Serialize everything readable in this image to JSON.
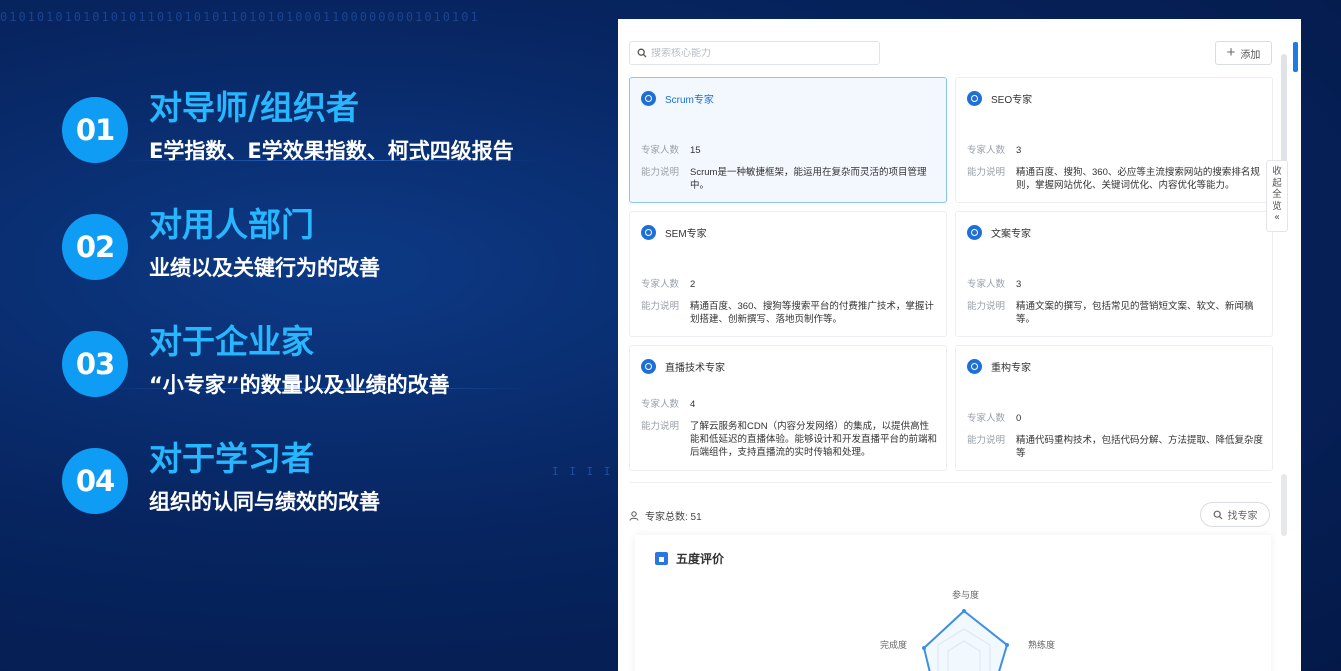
{
  "background_binary": "0101010101010101101010101101010100011000000001010101",
  "points": [
    {
      "num": "01",
      "title": "对导师/组织者",
      "desc": "E学指数、E学效果指数、柯式四级报告"
    },
    {
      "num": "02",
      "title": "对用人部门",
      "desc": "业绩以及关键行为的改善"
    },
    {
      "num": "03",
      "title": "对于企业家",
      "desc": "“小专家”的数量以及业绩的改善"
    },
    {
      "num": "04",
      "title": "对于学习者",
      "desc": "组织的认同与绩效的改善"
    }
  ],
  "panel": {
    "search_placeholder": "搜索核心能力",
    "add_label": "添加",
    "count_label": "专家人数",
    "desc_label": "能力说明",
    "cards": [
      {
        "name": "Scrum专家",
        "count": "15",
        "desc": "Scrum是一种敏捷框架，能运用在复杂而灵活的项目管理中。",
        "selected": true
      },
      {
        "name": "SEO专家",
        "count": "3",
        "desc": "精通百度、搜狗、360、必应等主流搜索网站的搜索排名规则，掌握网站优化、关键词优化、内容优化等能力。",
        "selected": false
      },
      {
        "name": "SEM专家",
        "count": "2",
        "desc": "精通百度、360、搜狗等搜索平台的付费推广技术，掌握计划搭建、创新撰写、落地页制作等。",
        "selected": false
      },
      {
        "name": "文案专家",
        "count": "3",
        "desc": "精通文案的撰写，包括常见的营销短文案、软文、新闻稿等。",
        "selected": false
      },
      {
        "name": "直播技术专家",
        "count": "4",
        "desc": "了解云服务和CDN（内容分发网络）的集成，以提供高性能和低延迟的直播体验。能够设计和开发直播平台的前端和后端组件，支持直播流的实时传输和处理。",
        "selected": false
      },
      {
        "name": "重构专家",
        "count": "0",
        "desc": "精通代码重构技术，包括代码分解、方法提取、降低复杂度等",
        "selected": false
      }
    ],
    "total_label": "专家总数: 51",
    "find_label": "找专家",
    "radar_title": "五度评价",
    "radar_axes": [
      "参与度",
      "熟练度",
      "完成度"
    ],
    "collapse_label": [
      "收",
      "起",
      "全",
      "览",
      "«"
    ]
  },
  "colors": {
    "accent": "#27b7ff",
    "badge": "#0f9cf5",
    "primary": "#1f6fd6"
  }
}
